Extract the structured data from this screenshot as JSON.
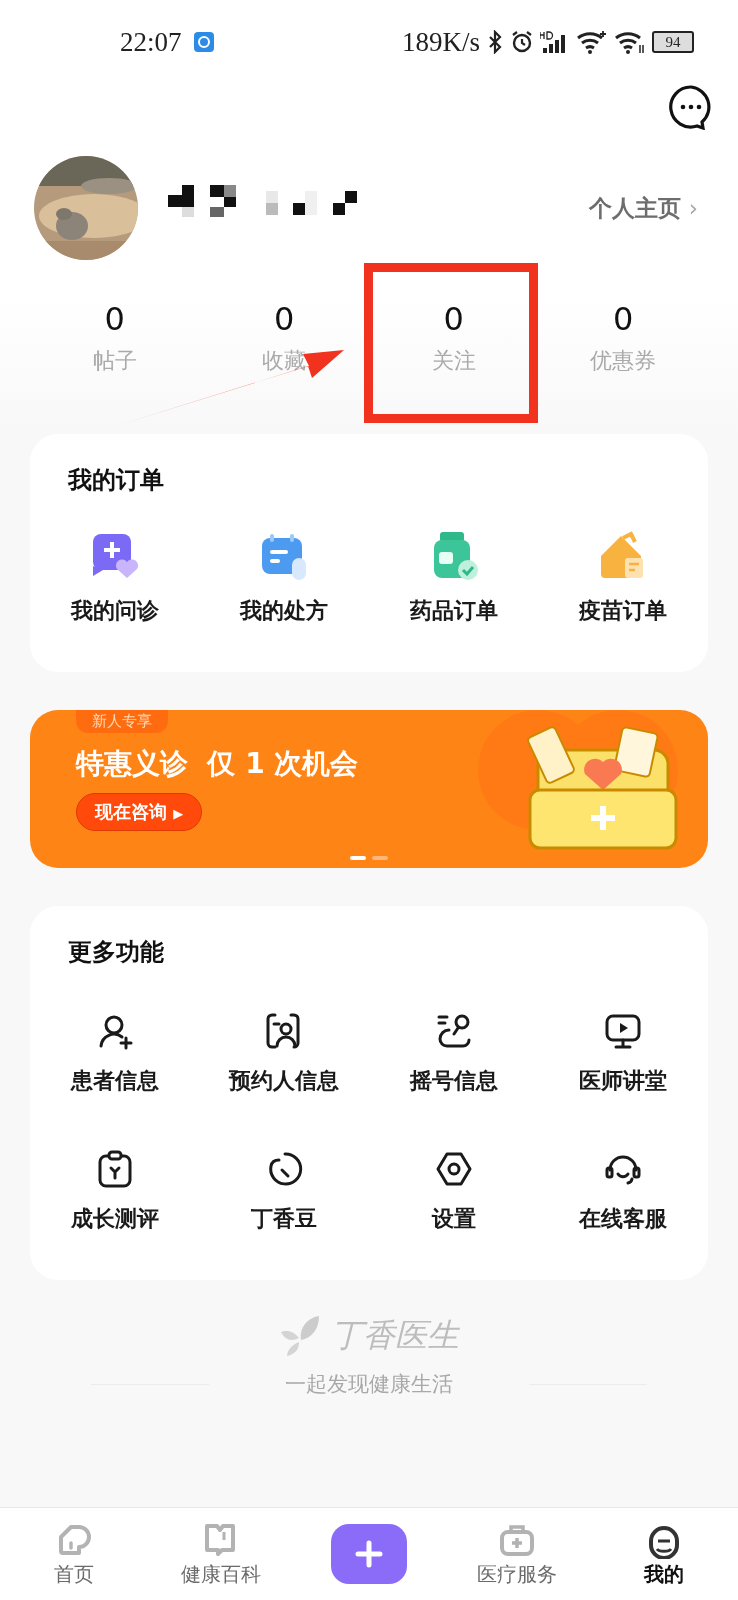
{
  "status_bar": {
    "time": "22:07",
    "speed": "189K/s",
    "battery": "94"
  },
  "profile": {
    "homepage_link": "个人主页",
    "homepage_arrow": "›"
  },
  "stats": [
    {
      "value": "0",
      "label": "帖子"
    },
    {
      "value": "0",
      "label": "收藏"
    },
    {
      "value": "0",
      "label": "关注"
    },
    {
      "value": "0",
      "label": "优惠券"
    }
  ],
  "orders": {
    "title": "我的订单",
    "items": [
      {
        "label": "我的问诊",
        "kind": "consult"
      },
      {
        "label": "我的处方",
        "kind": "prescription"
      },
      {
        "label": "药品订单",
        "kind": "medicine"
      },
      {
        "label": "疫苗订单",
        "kind": "vaccine"
      }
    ]
  },
  "banner": {
    "tag": "新人专享",
    "headline": "特惠义诊  仅 1 次机会",
    "button": "现在咨询",
    "button_arrow": "▶",
    "pager": [
      {
        "selected": true
      },
      {
        "selected": false
      }
    ]
  },
  "features": {
    "title": "更多功能",
    "items": [
      {
        "label": "患者信息",
        "kind": "patient"
      },
      {
        "label": "预约人信息",
        "kind": "booker"
      },
      {
        "label": "摇号信息",
        "kind": "lottery"
      },
      {
        "label": "医师讲堂",
        "kind": "lecture"
      },
      {
        "label": "成长测评",
        "kind": "growth"
      },
      {
        "label": "丁香豆",
        "kind": "bean"
      },
      {
        "label": "设置",
        "kind": "settings"
      },
      {
        "label": "在线客服",
        "kind": "service"
      }
    ]
  },
  "footer": {
    "brand": "丁香医生",
    "slogan": "一起发现健康生活"
  },
  "tab_bar": [
    {
      "label": "首页",
      "kind": "home",
      "selected": false
    },
    {
      "label": "健康百科",
      "kind": "book",
      "selected": false
    },
    {
      "kind": "plus",
      "selected": false
    },
    {
      "label": "医疗服务",
      "kind": "kit",
      "selected": false
    },
    {
      "label": "我的",
      "kind": "me",
      "selected": true
    }
  ],
  "highlight_box": {
    "color": "#f0321e"
  },
  "annotation_arrow": {
    "color": "#f0321e"
  }
}
